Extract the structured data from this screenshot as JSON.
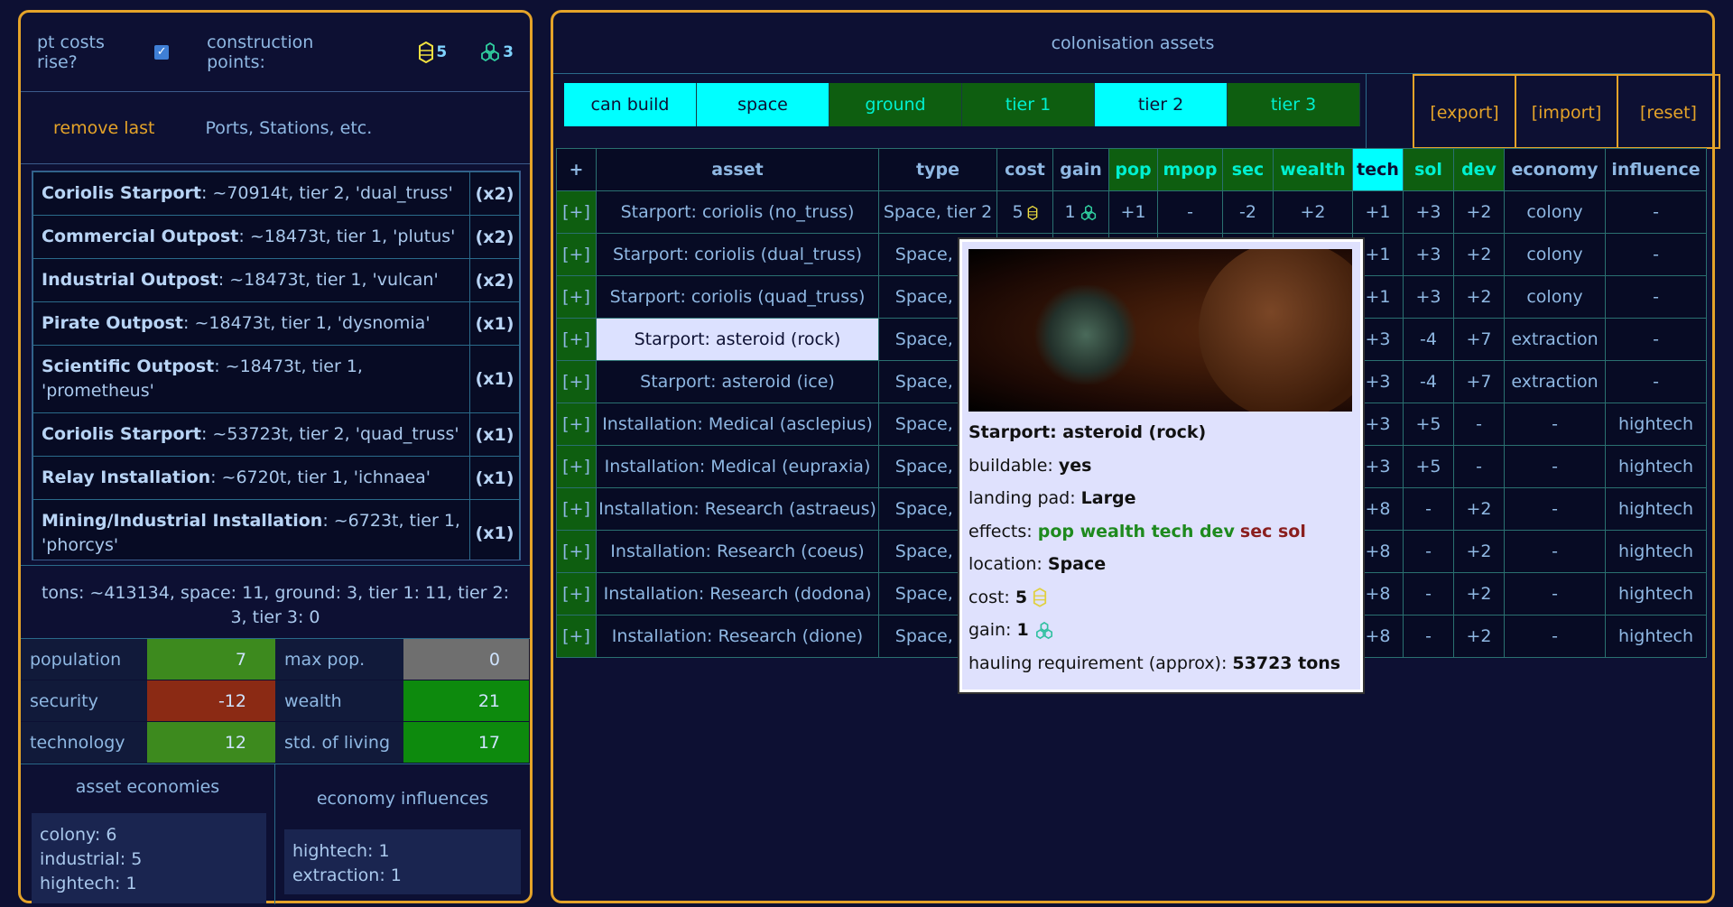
{
  "left": {
    "pt_label": "pt costs rise?",
    "cp_label": "construction points:",
    "cp_space": "5",
    "cp_ground": "3",
    "remove_last": "remove last",
    "ports_label": "Ports, Stations, etc.",
    "items": [
      {
        "name": "Coriolis Starport",
        "rest": ": ~70914t, tier 2, 'dual_truss'",
        "count": "(x2)"
      },
      {
        "name": "Commercial Outpost",
        "rest": ": ~18473t, tier 1, 'plutus'",
        "count": "(x2)"
      },
      {
        "name": "Industrial Outpost",
        "rest": ": ~18473t, tier 1, 'vulcan'",
        "count": "(x2)"
      },
      {
        "name": "Pirate Outpost",
        "rest": ": ~18473t, tier 1, 'dysnomia'",
        "count": "(x1)"
      },
      {
        "name": "Scientific Outpost",
        "rest": ": ~18473t, tier 1, 'prometheus'",
        "count": "(x1)"
      },
      {
        "name": "Coriolis Starport",
        "rest": ": ~53723t, tier 2, 'quad_truss'",
        "count": "(x1)"
      },
      {
        "name": "Relay Installation",
        "rest": ": ~6720t, tier 1, 'ichnaea'",
        "count": "(x1)"
      },
      {
        "name": "Mining/Industrial Installation",
        "rest": ": ~6723t, tier 1, 'phorcys'",
        "count": "(x1)"
      }
    ],
    "tons": "tons: ~413134, space: 11, ground: 3, tier 1: 11, tier 2: 3, tier 3: 0",
    "stats": {
      "population": "population",
      "population_v": "7",
      "maxpop": "max pop.",
      "maxpop_v": "0",
      "security": "security",
      "security_v": "-12",
      "wealth": "wealth",
      "wealth_v": "21",
      "technology": "technology",
      "technology_v": "12",
      "sol": "std. of living",
      "sol_v": "17"
    },
    "asset_econ_title": "asset economies",
    "asset_econ": [
      "colony: 6",
      "industrial: 5",
      "hightech: 1"
    ],
    "econ_infl_title": "economy influences",
    "econ_infl": [
      "hightech: 1",
      "extraction: 1"
    ]
  },
  "right": {
    "title": "colonisation assets",
    "filters": [
      "can build",
      "space",
      "ground",
      "tier 1",
      "tier 2",
      "tier 3"
    ],
    "actions": [
      "[export]",
      "[import]",
      "[reset]"
    ],
    "headers": [
      "+",
      "asset",
      "type",
      "cost",
      "gain",
      "pop",
      "mpop",
      "sec",
      "wealth",
      "tech",
      "sol",
      "dev",
      "economy",
      "influence"
    ],
    "rows": [
      [
        "[+]",
        "Starport: coriolis (no_truss)",
        "Space, tier 2",
        "5",
        "1",
        "+1",
        "-",
        "-2",
        "+2",
        "+1",
        "+3",
        "+2",
        "colony",
        "-"
      ],
      [
        "[+]",
        "Starport: coriolis (dual_truss)",
        "Space, tie",
        "",
        "",
        "",
        "",
        "",
        "",
        "+1",
        "+3",
        "+2",
        "colony",
        "-"
      ],
      [
        "[+]",
        "Starport: coriolis (quad_truss)",
        "Space, tie",
        "",
        "",
        "",
        "",
        "",
        "",
        "+1",
        "+3",
        "+2",
        "colony",
        "-"
      ],
      [
        "[+]",
        "Starport: asteroid (rock)",
        "Space, tie",
        "",
        "",
        "",
        "",
        "",
        "",
        "+3",
        "-4",
        "+7",
        "extraction",
        "-"
      ],
      [
        "[+]",
        "Starport: asteroid (ice)",
        "Space, tie",
        "",
        "",
        "",
        "",
        "",
        "",
        "+3",
        "-4",
        "+7",
        "extraction",
        "-"
      ],
      [
        "[+]",
        "Installation: Medical (asclepius)",
        "Space, tie",
        "",
        "",
        "",
        "",
        "",
        "",
        "+3",
        "+5",
        "-",
        "-",
        "hightech"
      ],
      [
        "[+]",
        "Installation: Medical (eupraxia)",
        "Space, tie",
        "",
        "",
        "",
        "",
        "",
        "",
        "+3",
        "+5",
        "-",
        "-",
        "hightech"
      ],
      [
        "[+]",
        "Installation: Research (astraeus)",
        "Space, tie",
        "",
        "",
        "",
        "",
        "",
        "",
        "+8",
        "-",
        "+2",
        "-",
        "hightech"
      ],
      [
        "[+]",
        "Installation: Research (coeus)",
        "Space, tie",
        "",
        "",
        "",
        "",
        "",
        "",
        "+8",
        "-",
        "+2",
        "-",
        "hightech"
      ],
      [
        "[+]",
        "Installation: Research (dodona)",
        "Space, tie",
        "",
        "",
        "",
        "",
        "",
        "",
        "+8",
        "-",
        "+2",
        "-",
        "hightech"
      ],
      [
        "[+]",
        "Installation: Research (dione)",
        "Space, tie",
        "",
        "",
        "",
        "",
        "",
        "",
        "+8",
        "-",
        "+2",
        "-",
        "hightech"
      ]
    ]
  },
  "popup": {
    "title": "Starport: asteroid (rock)",
    "buildable_l": "buildable:",
    "buildable_v": "yes",
    "pad_l": "landing pad:",
    "pad_v": "Large",
    "effects_l": "effects:",
    "effects_pos": "pop wealth tech dev",
    "effects_neg": "sec sol",
    "loc_l": "location:",
    "loc_v": "Space",
    "cost_l": "cost:",
    "cost_v": "5",
    "gain_l": "gain:",
    "gain_v": "1",
    "haul_l": "hauling requirement (approx):",
    "haul_v": "53723 tons"
  }
}
